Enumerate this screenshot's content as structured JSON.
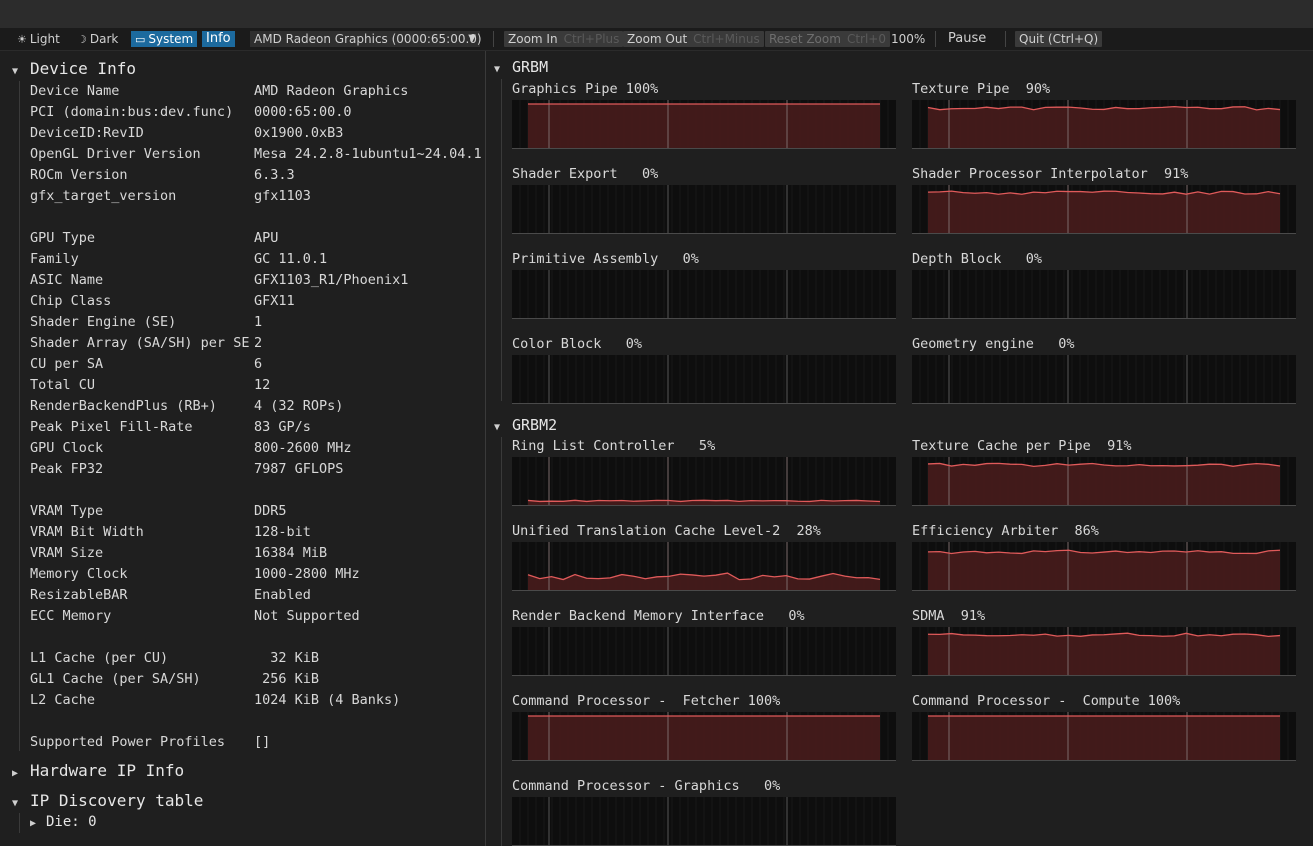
{
  "toolbar": {
    "light": "Light",
    "dark": "Dark",
    "system": "System",
    "info": "Info",
    "gpu_select": "AMD Radeon Graphics (0000:65:00.0)",
    "zoom_in": "Zoom In",
    "zoom_in_shortcut": "Ctrl+Plus",
    "zoom_out": "Zoom Out",
    "zoom_out_shortcut": "Ctrl+Minus",
    "reset_zoom": "Reset Zoom",
    "reset_zoom_shortcut": "Ctrl+0",
    "zoom_level": "100%",
    "pause": "Pause",
    "quit": "Quit (Ctrl+Q)"
  },
  "device_info": {
    "title": "Device Info",
    "rows": [
      {
        "k": "Device Name",
        "v": "AMD Radeon Graphics"
      },
      {
        "k": "PCI (domain:bus:dev.func)",
        "v": "0000:65:00.0"
      },
      {
        "k": "DeviceID:RevID",
        "v": "0x1900.0xB3"
      },
      {
        "k": "OpenGL Driver Version",
        "v": "Mesa 24.2.8-1ubuntu1~24.04.1"
      },
      {
        "k": "ROCm Version",
        "v": "6.3.3"
      },
      {
        "k": "gfx_target_version",
        "v": "gfx1103"
      },
      {
        "k": "GPU Type",
        "v": "APU"
      },
      {
        "k": "Family",
        "v": "GC 11.0.1"
      },
      {
        "k": "ASIC Name",
        "v": "GFX1103_R1/Phoenix1"
      },
      {
        "k": "Chip Class",
        "v": "GFX11"
      },
      {
        "k": "Shader Engine (SE)",
        "v": "1"
      },
      {
        "k": "Shader Array (SA/SH) per SE",
        "v": "2"
      },
      {
        "k": "CU per SA",
        "v": "6"
      },
      {
        "k": "Total CU",
        "v": "12"
      },
      {
        "k": "RenderBackendPlus (RB+)",
        "v": "4 (32 ROPs)"
      },
      {
        "k": "Peak Pixel Fill-Rate",
        "v": "83 GP/s"
      },
      {
        "k": "GPU Clock",
        "v": "800-2600 MHz"
      },
      {
        "k": "Peak FP32",
        "v": "7987 GFLOPS"
      },
      {
        "k": "VRAM Type",
        "v": "DDR5"
      },
      {
        "k": "VRAM Bit Width",
        "v": "128-bit"
      },
      {
        "k": "VRAM Size",
        "v": "16384 MiB"
      },
      {
        "k": "Memory Clock",
        "v": "1000-2800 MHz"
      },
      {
        "k": "ResizableBAR",
        "v": "Enabled"
      },
      {
        "k": "ECC Memory",
        "v": "Not Supported"
      },
      {
        "k": "L1 Cache (per CU)",
        "v": "  32 KiB"
      },
      {
        "k": "GL1 Cache (per SA/SH)",
        "v": " 256 KiB"
      },
      {
        "k": "L2 Cache",
        "v": "1024 KiB (4 Banks)"
      },
      {
        "k": "Supported Power Profiles",
        "v": "[]"
      }
    ]
  },
  "hardware_ip": {
    "title": "Hardware IP Info"
  },
  "ip_discovery": {
    "title": "IP Discovery table",
    "die": "Die: 0"
  },
  "grbm": {
    "title": "GRBM",
    "graphs": [
      {
        "label": "Graphics Pipe 100%",
        "value": 100
      },
      {
        "label": "Texture Pipe  90%",
        "value": 90
      },
      {
        "label": "Shader Export   0%",
        "value": 0
      },
      {
        "label": "Shader Processor Interpolator  91%",
        "value": 91
      },
      {
        "label": "Primitive Assembly   0%",
        "value": 0
      },
      {
        "label": "Depth Block   0%",
        "value": 0
      },
      {
        "label": "Color Block   0%",
        "value": 0
      },
      {
        "label": "Geometry engine   0%",
        "value": 0
      }
    ]
  },
  "grbm2": {
    "title": "GRBM2",
    "graphs": [
      {
        "label": "Ring List Controller   5%",
        "value": 5
      },
      {
        "label": "Texture Cache per Pipe  91%",
        "value": 91
      },
      {
        "label": "Unified Translation Cache Level-2  28%",
        "value": 28
      },
      {
        "label": "Efficiency Arbiter  86%",
        "value": 86
      },
      {
        "label": "Render Backend Memory Interface   0%",
        "value": 0
      },
      {
        "label": "SDMA  91%",
        "value": 91
      },
      {
        "label": "Command Processor -  Fetcher 100%",
        "value": 100
      },
      {
        "label": "Command Processor -  Compute 100%",
        "value": 100
      },
      {
        "label": "Command Processor - Graphics   0%",
        "value": 0
      }
    ]
  },
  "colors": {
    "accent": "#1c6a9e",
    "graph_line": "#e05a5a",
    "graph_fill": "#4a1c1c"
  }
}
